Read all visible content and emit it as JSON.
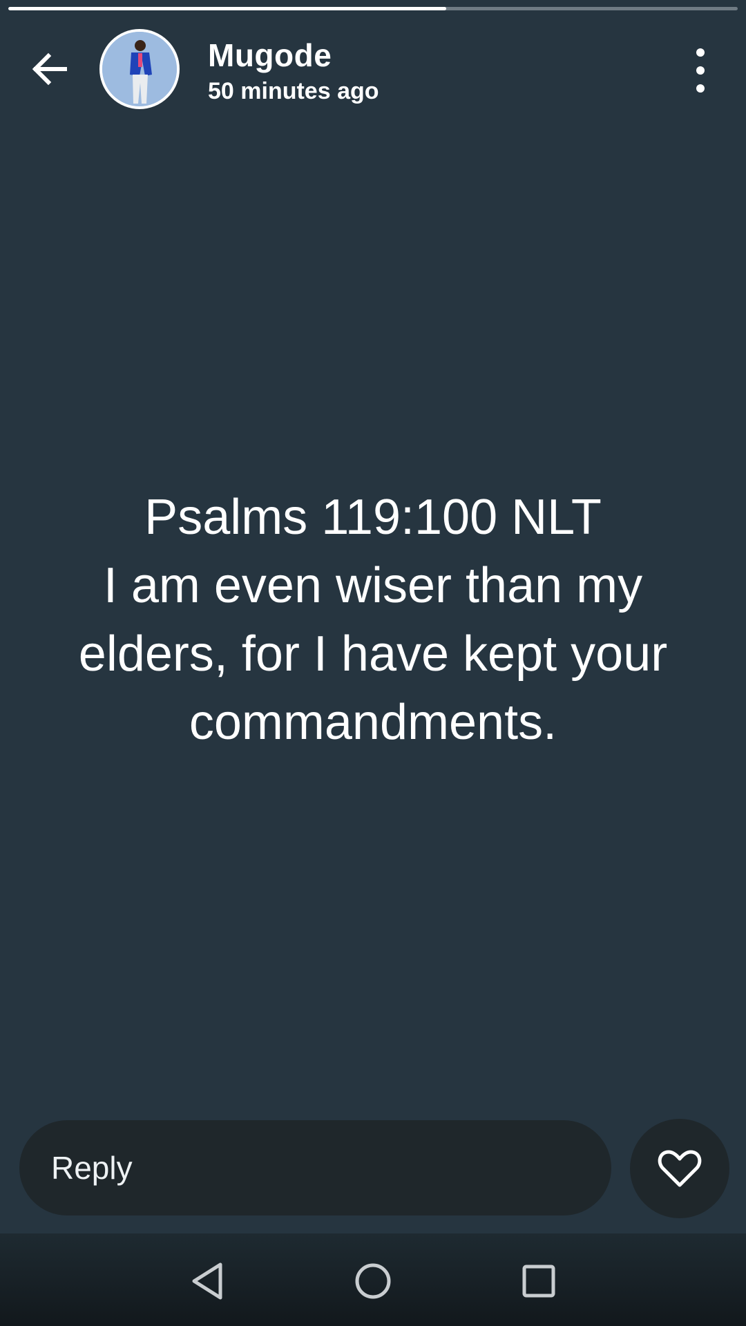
{
  "progress": {
    "fraction": 0.6
  },
  "header": {
    "username": "Mugode",
    "timestamp": "50 minutes ago"
  },
  "status": {
    "text_line1": "Psalms 119:100 NLT",
    "text_body": "I am even wiser than my elders, for I have kept your commandments.",
    "background_color": "#263540"
  },
  "reply": {
    "placeholder": "Reply"
  },
  "icons": {
    "back": "arrow-left-icon",
    "more": "more-vertical-icon",
    "like": "heart-outline-icon",
    "nav_back": "triangle-back-icon",
    "nav_home": "circle-home-icon",
    "nav_recents": "square-recents-icon"
  }
}
